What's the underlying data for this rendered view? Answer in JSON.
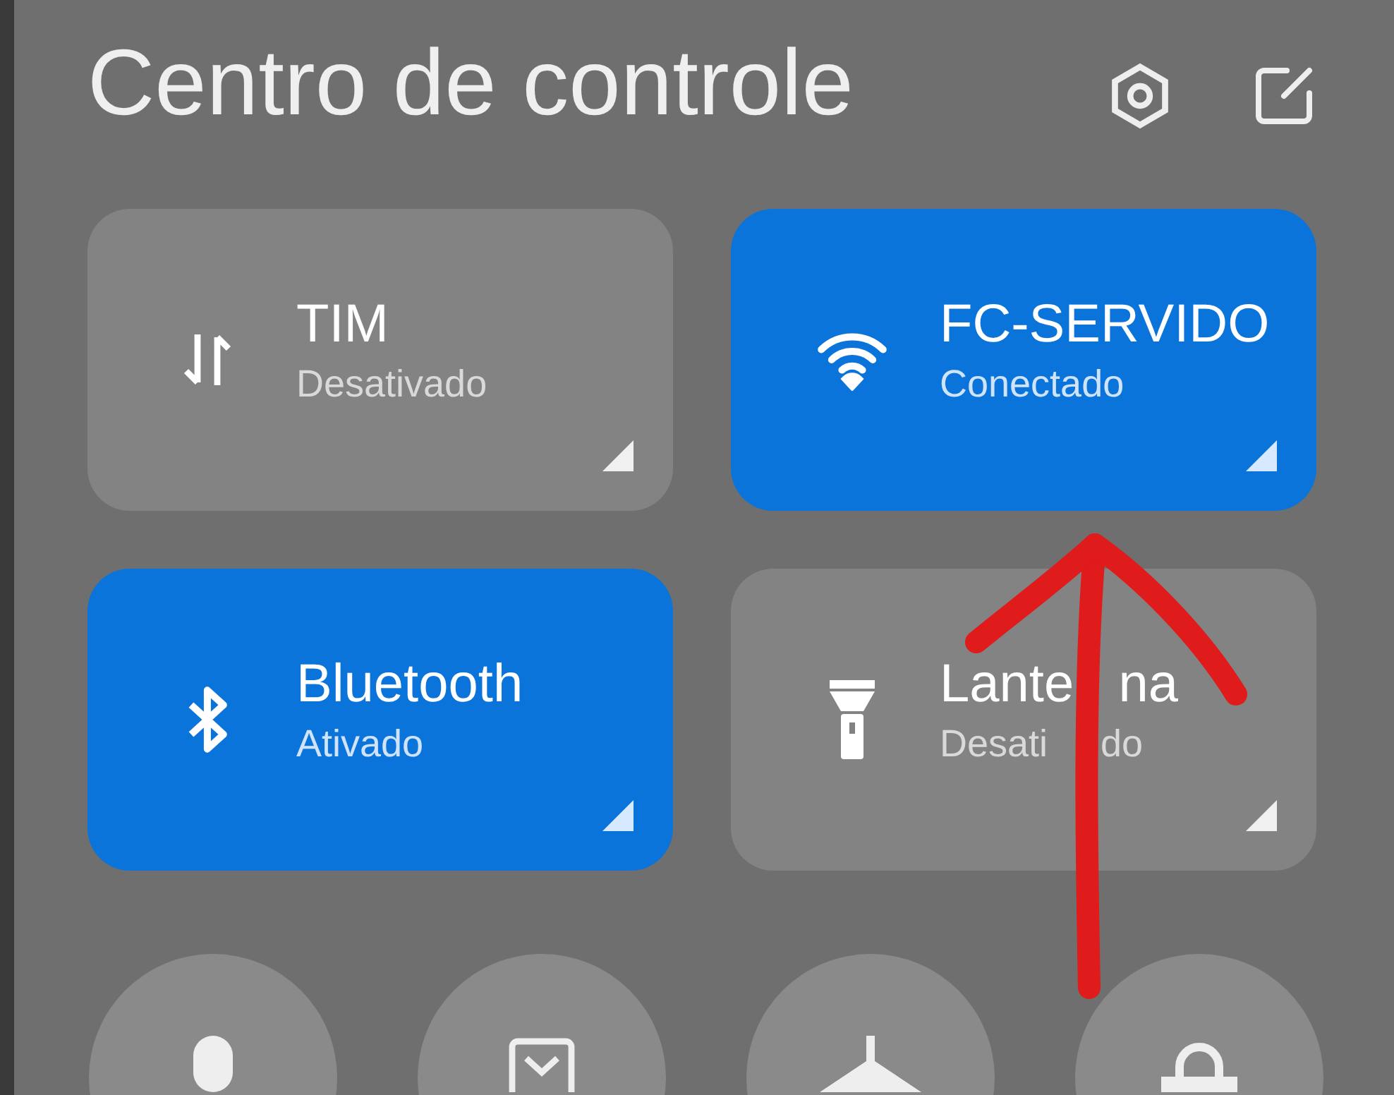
{
  "header": {
    "title": "Centro de controle"
  },
  "tiles": [
    {
      "title": "TIM",
      "status": "Desativado",
      "on": false
    },
    {
      "title": "FC-SERVIDO",
      "status": "Conectado",
      "on": true
    },
    {
      "title": "Bluetooth",
      "status": "Ativado",
      "on": true
    },
    {
      "title": "Lante   na",
      "status": "Desati     do",
      "on": false
    }
  ],
  "quick_toggles": [
    {
      "on": false
    },
    {
      "on": false
    },
    {
      "on": false
    },
    {
      "on": false
    }
  ]
}
